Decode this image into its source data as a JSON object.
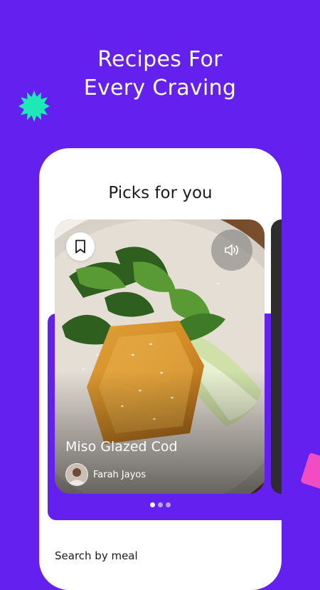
{
  "promo": {
    "headline_line1": "Recipes For",
    "headline_line2": "Every Craving"
  },
  "colors": {
    "brand_purple": "#6320EE",
    "accent_green": "#1DE9B6",
    "accent_pink": "#F14CC1"
  },
  "screen": {
    "section_title": "Picks for you",
    "featured_card": {
      "title": "Miso Glazed Cod",
      "author": "Farah Jayos",
      "bookmark_icon": "bookmark-icon",
      "sound_icon": "volume-icon"
    },
    "carousel": {
      "total_pages": 3,
      "active_page": 1
    },
    "search_by_meal_label": "Search by meal"
  }
}
